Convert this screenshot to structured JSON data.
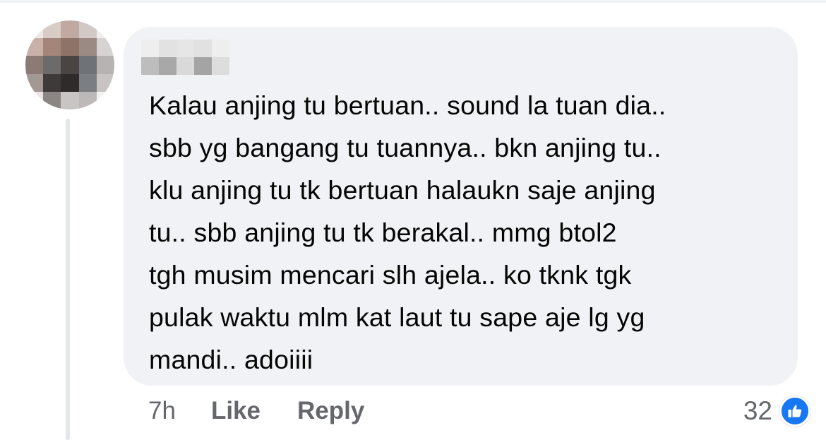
{
  "comment": {
    "lines": [
      "Kalau anjing tu bertuan.. sound la tuan dia..",
      "sbb yg bangang tu tuannya.. bkn anjing tu..",
      "klu anjing tu tk bertuan halaukn saje anjing",
      "tu.. sbb anjing tu tk berakal.. mmg btol2",
      "tgh musim mencari slh ajela.. ko tknk tgk",
      "pulak waktu mlm kat laut tu sape aje lg yg",
      "mandi.. adoiiii"
    ]
  },
  "actions": {
    "timestamp": "7h",
    "like_label": "Like",
    "reply_label": "Reply"
  },
  "reactions": {
    "count": "32",
    "icon": "thumbs-up-icon",
    "color": "#1877f2"
  },
  "colors": {
    "bubble": "#f0f2f5",
    "text": "#050505",
    "secondary_text": "#65676b"
  }
}
